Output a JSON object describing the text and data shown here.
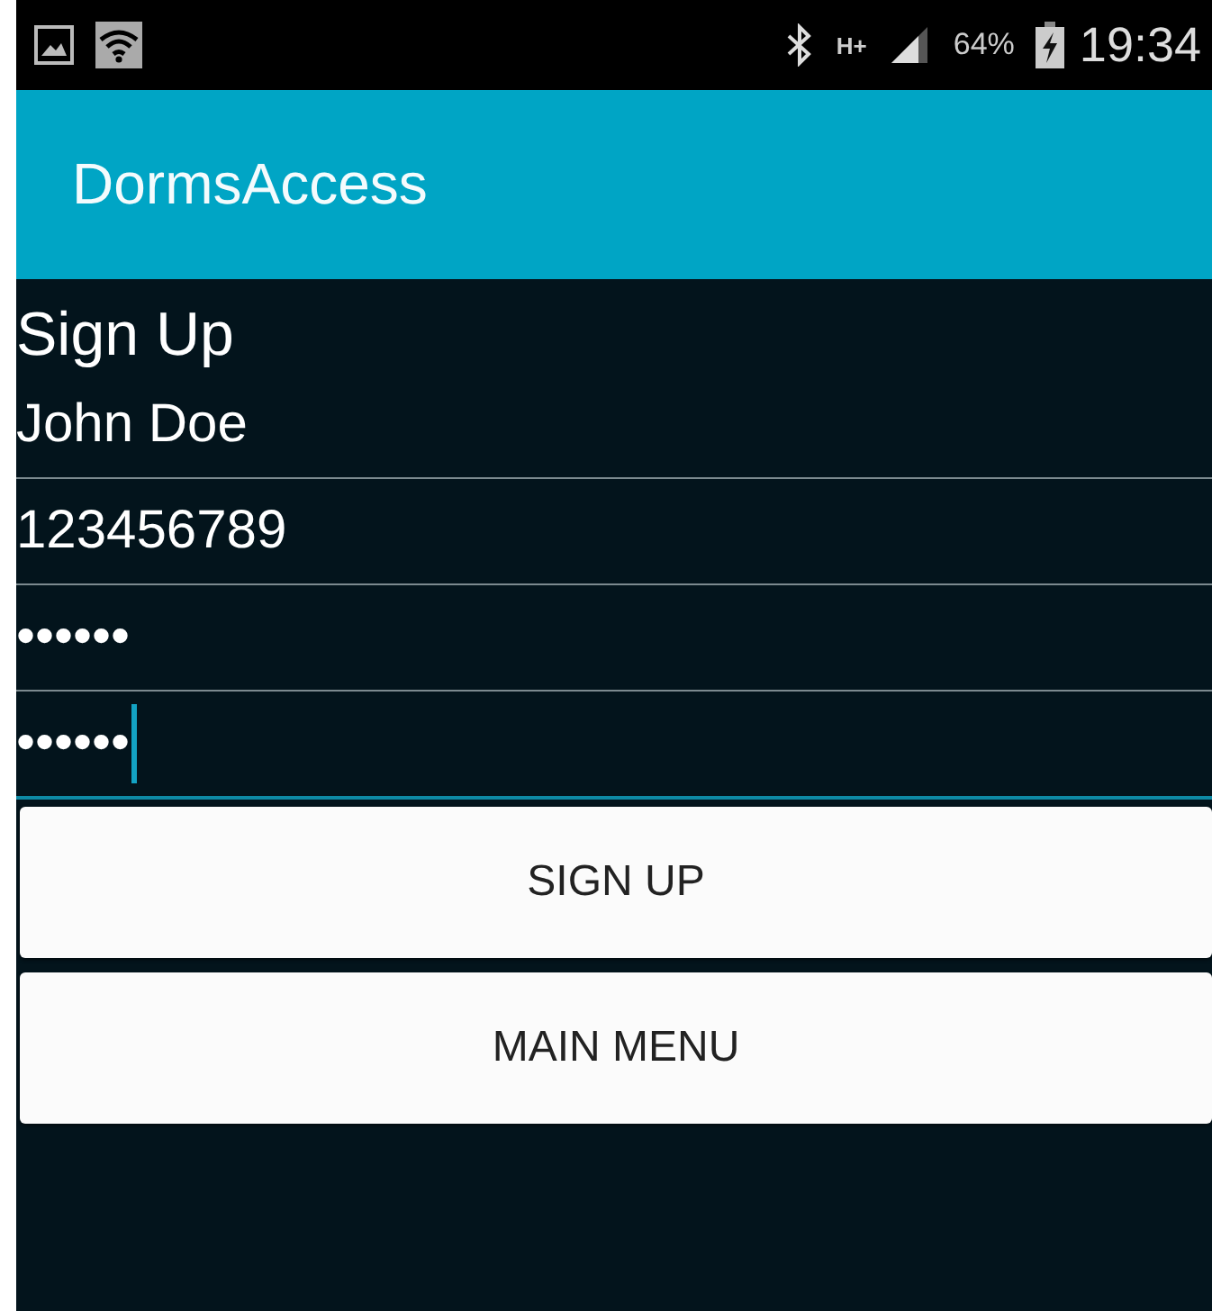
{
  "status_bar": {
    "battery": "64%",
    "time": "19:34",
    "network": "H+"
  },
  "app_bar": {
    "title": "DormsAccess"
  },
  "heading": "Sign Up",
  "fields": [
    {
      "value": "John Doe",
      "focused": false
    },
    {
      "value": "123456789",
      "focused": false
    },
    {
      "value": "••••••",
      "focused": false
    },
    {
      "value": "••••••",
      "focused": true
    }
  ],
  "buttons": [
    "SIGN UP",
    "MAIN MENU"
  ]
}
